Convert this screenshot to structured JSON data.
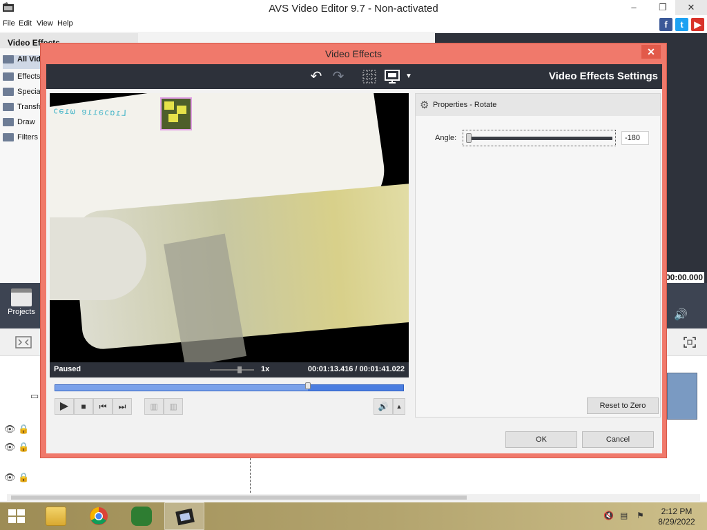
{
  "app": {
    "title": "AVS Video Editor 9.7 - Non-activated",
    "menu": [
      "File",
      "Edit",
      "View",
      "Help"
    ],
    "window_controls": [
      "–",
      "❐",
      "✕"
    ]
  },
  "social": [
    {
      "name": "facebook",
      "glyph": "f",
      "color": "#3b5998"
    },
    {
      "name": "twitter",
      "glyph": "t",
      "color": "#1da1f2"
    },
    {
      "name": "youtube",
      "glyph": "▶",
      "color": "#d9322a"
    }
  ],
  "left_panel": {
    "header": "Video Effects",
    "items": [
      "All Video Effects",
      "Effects",
      "Special",
      "Transform",
      "Draw",
      "Filters"
    ],
    "selected_index": 0,
    "projects_label": "Projects"
  },
  "right_panel": {
    "time": "00:00.000"
  },
  "dialog": {
    "title": "Video Effects",
    "close_glyph": "✕",
    "settings_title": "Video Effects Settings",
    "toolbar_icons": [
      "undo-icon",
      "redo-icon",
      "grid-icon",
      "monitor-icon",
      "dropdown-icon"
    ],
    "video": {
      "overlay_text": "Lıɑɔǝııɐ ωıǝɔ"
    },
    "status": {
      "state": "Paused",
      "speed": "1x",
      "current_time": "00:01:13.416",
      "separator": "/",
      "total_time": "00:01:41.022",
      "progress": 0.727
    },
    "properties": {
      "header": "Properties - Rotate",
      "angle_label": "Angle:",
      "angle_value": "-180",
      "reset_label": "Reset to Zero"
    },
    "buttons": {
      "ok": "OK",
      "cancel": "Cancel"
    }
  },
  "taskbar": {
    "apps": [
      "file-explorer",
      "chrome",
      "game-app",
      "avs-video-editor"
    ],
    "time": "2:12 PM",
    "date": "8/29/2022"
  }
}
